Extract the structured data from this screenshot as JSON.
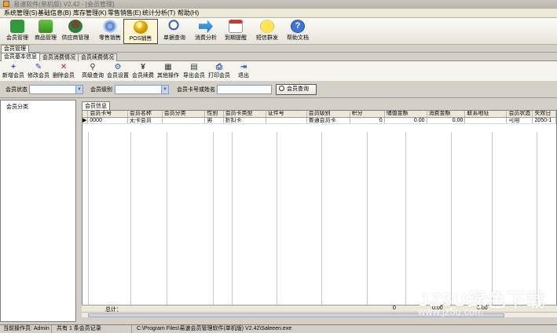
{
  "window": {
    "title": "易速软件(单机版) V2.42 - [会员管理]"
  },
  "menu": [
    "系统管理(S)",
    "基础信息(B)",
    "库存管理(K)",
    "零售销售(E)",
    "统计分析(T)",
    "帮助(H)"
  ],
  "toolbar": [
    {
      "label": "会员管理",
      "icon": "member-icon"
    },
    {
      "label": "商品管理",
      "icon": "goods-icon"
    },
    {
      "label": "供应商管理",
      "icon": "supplier-icon"
    },
    {
      "label": "零售销售",
      "icon": "retail-icon"
    },
    {
      "label": "POS销售",
      "icon": "pos-icon"
    },
    {
      "label": "单据查询",
      "icon": "doc-search-icon"
    },
    {
      "label": "消费分析",
      "icon": "analysis-icon"
    },
    {
      "label": "到期提醒",
      "icon": "calendar-icon"
    },
    {
      "label": "短信群发",
      "icon": "sms-icon"
    },
    {
      "label": "帮助文档",
      "icon": "help-icon"
    }
  ],
  "module_tab": "会员管理",
  "subtabs": [
    "会员基本信息",
    "会员消费情况",
    "会员续费情况"
  ],
  "actions": [
    {
      "label": "新增会员",
      "glyph": "+"
    },
    {
      "label": "修改会员",
      "glyph": "✎"
    },
    {
      "label": "删除会员",
      "glyph": "✕"
    },
    {
      "label": "高级查询",
      "glyph": "⚲"
    },
    {
      "label": "会员设置",
      "glyph": "⚙"
    },
    {
      "label": "会员续费",
      "glyph": "¥"
    },
    {
      "label": "其他操作",
      "glyph": "▦"
    },
    {
      "label": "导出会员",
      "glyph": "▤"
    },
    {
      "label": "打印会员",
      "glyph": "⎙"
    },
    {
      "label": "退出",
      "glyph": "⇥"
    }
  ],
  "filters": {
    "status_label": "会员状态",
    "status_value": "",
    "level_label": "会员级别",
    "level_value": "",
    "keyword_label": "会员卡号或姓名",
    "keyword_value": "",
    "query_button": "会员查询"
  },
  "tree": {
    "root": "会员分类"
  },
  "grid": {
    "tab": "会员信息",
    "columns": [
      "会员卡号",
      "会员名称",
      "会员分类",
      "性别",
      "会员卡类型",
      "证件号",
      "会员级别",
      "积分",
      "储值金额",
      "消费金额",
      "联系地址",
      "会员状态",
      "失效日"
    ],
    "rows": [
      [
        "0000",
        "无卡会员",
        "",
        "男",
        "折扣卡",
        "",
        "普通会员卡",
        "0",
        "0.00",
        "0.00",
        "",
        "可用",
        "2050-1"
      ]
    ],
    "total_label": "总计：",
    "totals": {
      "points": "0",
      "stored": "0.00",
      "spent": "0.00"
    }
  },
  "status": {
    "operator": "当前操作员: Admin",
    "count": "共有 1 条会员记录",
    "path": "C:\\Program Files\\易速会员管理软件(单机版) V2.42\\Saleeen.exe"
  },
  "watermark": {
    "brand": "JZ5U绿色下载",
    "url": "www.jz5u.com"
  }
}
